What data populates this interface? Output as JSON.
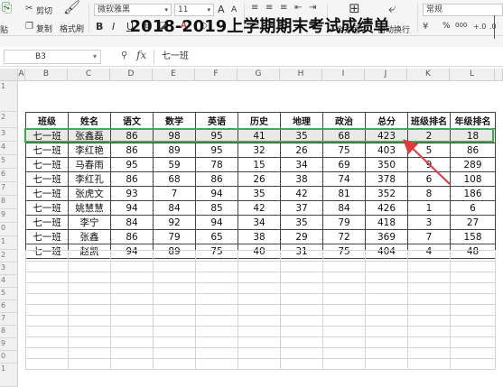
{
  "ribbon": {
    "cut": "剪切",
    "paste_partial": "贴",
    "copy": "复制",
    "format_painter": "格式刷",
    "font_name": "微软雅黑",
    "font_size": "11",
    "bold": "B",
    "italic": "I",
    "underline": "U",
    "font_grow": "A",
    "font_shrink": "A",
    "merge_center": "合并居中",
    "wrap_text": "自动换行",
    "number_format": "常规",
    "percent": "%",
    "thousands": "000"
  },
  "formula_bar": {
    "cell_ref": "B3",
    "fx": "fx",
    "content": "七一班"
  },
  "columns": [
    "A",
    "B",
    "C",
    "D",
    "E",
    "F",
    "G",
    "H",
    "I",
    "J",
    "K",
    "L"
  ],
  "row_numbers": [
    "1",
    "2",
    "3",
    "4",
    "5",
    "6",
    "7",
    "8",
    "9",
    "0",
    "1",
    "2",
    "3",
    "4",
    "5",
    "6",
    "7",
    "8",
    "9",
    "0",
    "1"
  ],
  "sheet": {
    "title": "2018-2019上学期期末考试成绩单",
    "headers": [
      "班级",
      "姓名",
      "语文",
      "数学",
      "英语",
      "历史",
      "地理",
      "政治",
      "总分",
      "班级排名",
      "年级排名"
    ],
    "rows": [
      [
        "七一班",
        "张鑫磊",
        "86",
        "98",
        "95",
        "41",
        "35",
        "68",
        "423",
        "2",
        "18"
      ],
      [
        "七一班",
        "李红艳",
        "86",
        "89",
        "95",
        "32",
        "26",
        "75",
        "403",
        "5",
        "86"
      ],
      [
        "七一班",
        "马春雨",
        "95",
        "59",
        "78",
        "15",
        "34",
        "69",
        "350",
        "9",
        "289"
      ],
      [
        "七一班",
        "李红孔",
        "86",
        "68",
        "86",
        "26",
        "38",
        "74",
        "378",
        "6",
        "108"
      ],
      [
        "七一班",
        "张虎文",
        "93",
        "7",
        "94",
        "35",
        "42",
        "81",
        "352",
        "8",
        "186"
      ],
      [
        "七一班",
        "姚慧慧",
        "94",
        "84",
        "85",
        "42",
        "37",
        "84",
        "426",
        "1",
        "6"
      ],
      [
        "七一班",
        "李宁",
        "84",
        "92",
        "94",
        "34",
        "35",
        "79",
        "418",
        "3",
        "27"
      ],
      [
        "七一班",
        "张鑫",
        "86",
        "79",
        "65",
        "38",
        "29",
        "72",
        "369",
        "7",
        "158"
      ],
      [
        "七一班",
        "赵凯",
        "94",
        "89",
        "75",
        "40",
        "31",
        "75",
        "404",
        "4",
        "48"
      ]
    ]
  },
  "colors": {
    "selection": "#3fae49",
    "arrow": "#e0393e"
  }
}
